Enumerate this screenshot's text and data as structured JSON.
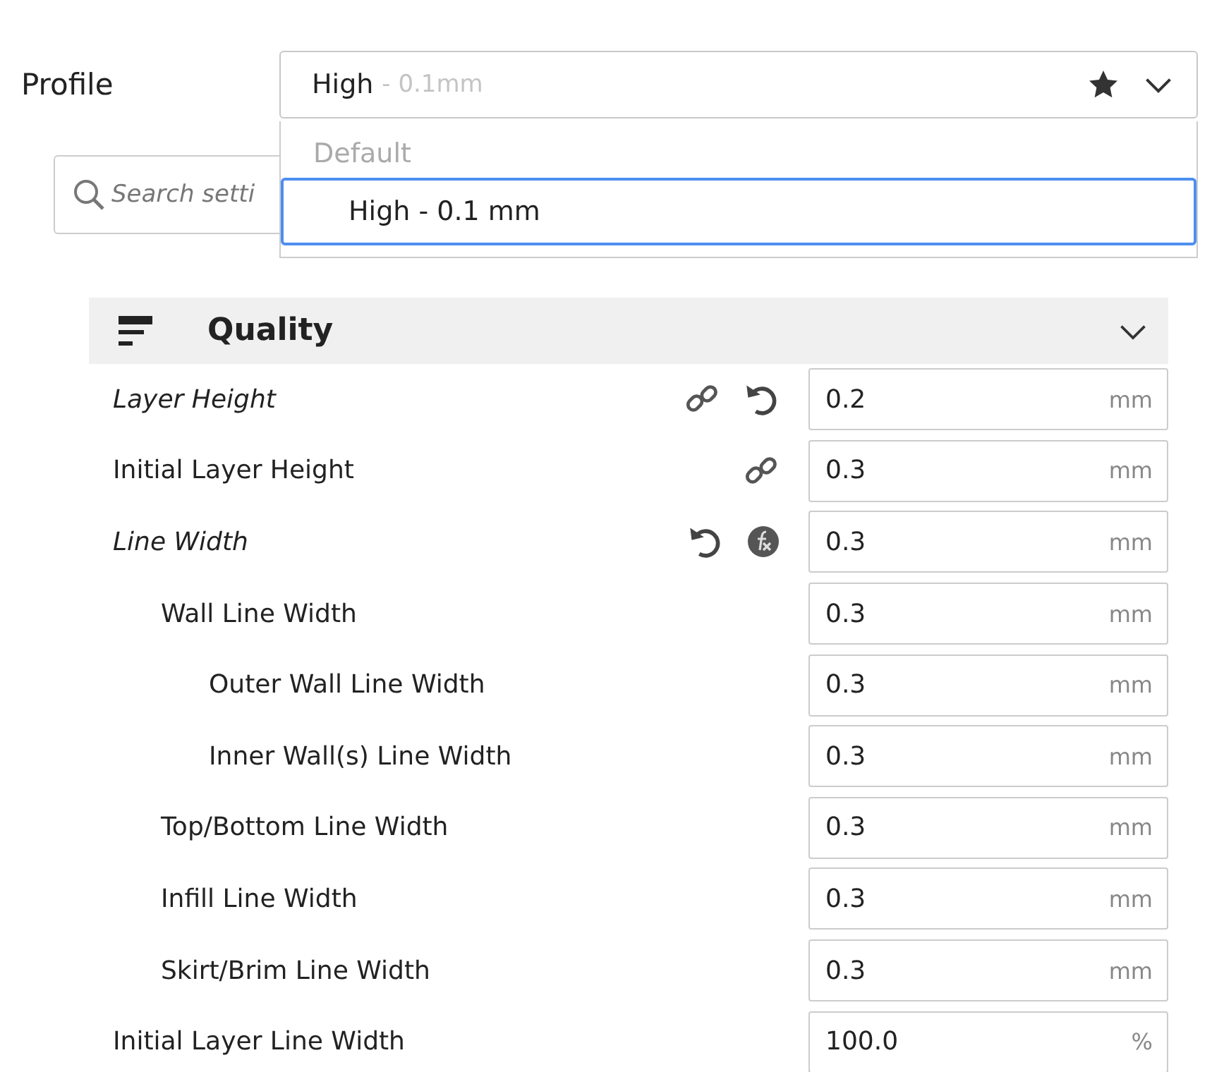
{
  "profile": {
    "label": "Profile",
    "value": "High",
    "detail": "- 0.1mm",
    "favorite": true,
    "menu": {
      "section": "Default",
      "items": [
        {
          "label": "High - 0.1 mm",
          "selected": true
        }
      ]
    }
  },
  "search": {
    "placeholder": "Search setti"
  },
  "category": {
    "title": "Quality",
    "expanded": true
  },
  "settings": [
    {
      "label": "Layer Height",
      "modified": true,
      "linked": true,
      "resettable": true,
      "has_function": false,
      "value": "0.2",
      "unit": "mm"
    },
    {
      "label": "Initial Layer Height",
      "modified": false,
      "linked": true,
      "resettable": false,
      "has_function": false,
      "value": "0.3",
      "unit": "mm"
    },
    {
      "label": "Line Width",
      "modified": true,
      "linked": false,
      "resettable": true,
      "has_function": true,
      "value": "0.3",
      "unit": "mm",
      "children": [
        {
          "label": "Wall Line Width",
          "modified": false,
          "linked": false,
          "resettable": false,
          "has_function": false,
          "value": "0.3",
          "unit": "mm",
          "children": [
            {
              "label": "Outer Wall Line Width",
              "modified": false,
              "linked": false,
              "resettable": false,
              "has_function": false,
              "value": "0.3",
              "unit": "mm"
            },
            {
              "label": "Inner Wall(s) Line Width",
              "modified": false,
              "linked": false,
              "resettable": false,
              "has_function": false,
              "value": "0.3",
              "unit": "mm"
            }
          ]
        },
        {
          "label": "Top/Bottom Line Width",
          "modified": false,
          "linked": false,
          "resettable": false,
          "has_function": false,
          "value": "0.3",
          "unit": "mm"
        },
        {
          "label": "Infill Line Width",
          "modified": false,
          "linked": false,
          "resettable": false,
          "has_function": false,
          "value": "0.3",
          "unit": "mm"
        },
        {
          "label": "Skirt/Brim Line Width",
          "modified": false,
          "linked": false,
          "resettable": false,
          "has_function": false,
          "value": "0.3",
          "unit": "mm"
        }
      ]
    },
    {
      "label": "Initial Layer Line Width",
      "modified": false,
      "linked": false,
      "resettable": false,
      "has_function": false,
      "value": "100.0",
      "unit": "%"
    }
  ]
}
